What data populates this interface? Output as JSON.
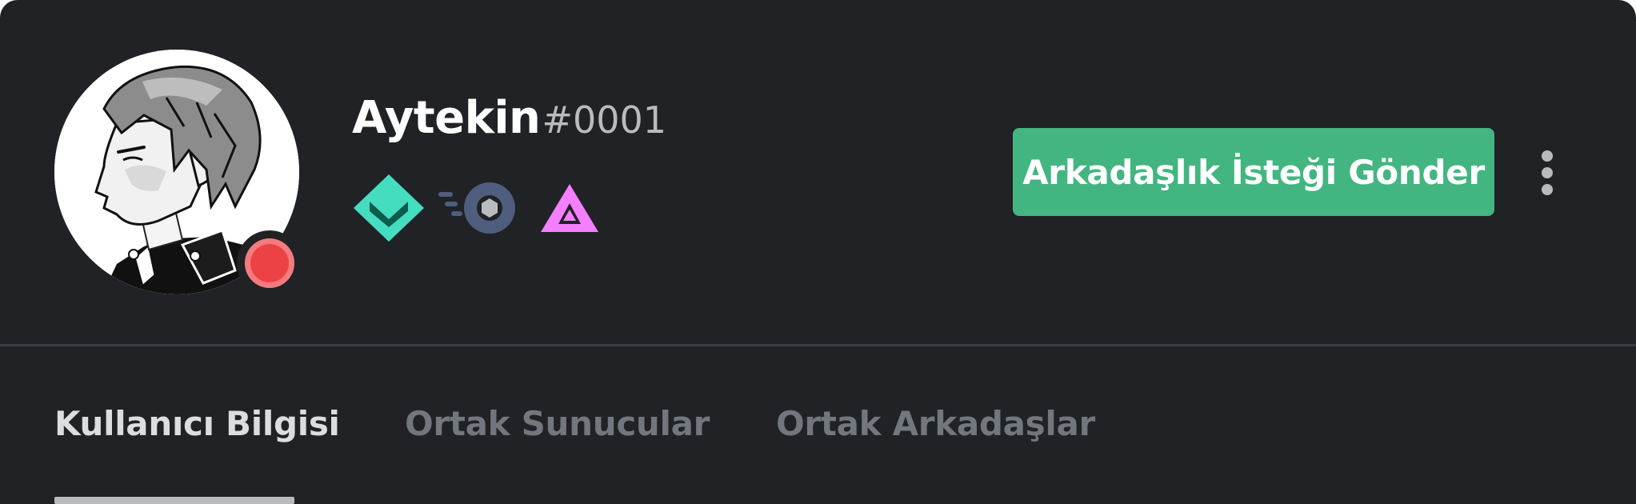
{
  "user": {
    "username": "Aytekin",
    "discriminator": "#0001",
    "status": "do-not-disturb"
  },
  "badges": [
    {
      "icon": "hypesquad-icon",
      "color": "#45ddc0"
    },
    {
      "icon": "nitro-icon",
      "color": "#4f5d7e"
    },
    {
      "icon": "early-supporter-icon",
      "color": "#f47fff"
    }
  ],
  "actions": {
    "add_friend_label": "Arkadaşlık İsteği Gönder",
    "more_icon": "more-vertical-icon"
  },
  "tabs": [
    {
      "label": "Kullanıcı Bilgisi",
      "active": true
    },
    {
      "label": "Ortak Sunucular",
      "active": false
    },
    {
      "label": "Ortak Arkadaşlar",
      "active": false
    }
  ],
  "colors": {
    "background": "#202225",
    "accent_button": "#43b581",
    "status_dnd": "#ed4245",
    "tab_active": "#dcddde",
    "tab_inactive": "#72767d"
  }
}
